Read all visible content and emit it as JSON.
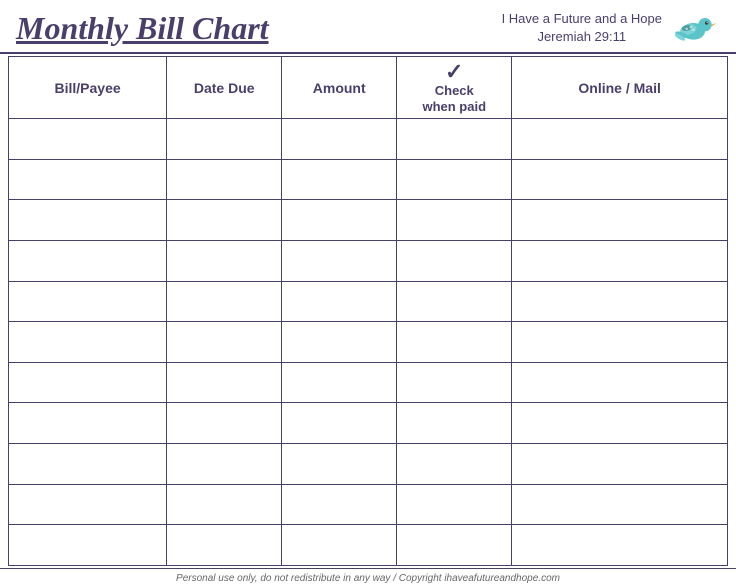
{
  "header": {
    "title": "Monthly Bill Chart",
    "subtitle_line1": "I Have a Future and a Hope",
    "subtitle_line2": "Jeremiah 29:11"
  },
  "columns": {
    "bill_payee": "Bill/Payee",
    "date_due": "Date Due",
    "amount": "Amount",
    "check_symbol": "✓",
    "check_when_paid_line1": "Check",
    "check_when_paid_line2": "when paid",
    "online_mail": "Online / Mail"
  },
  "rows": 11,
  "footer": "Personal use only, do not redistribute in any way / Copyright ihaveafutureandhope.com"
}
